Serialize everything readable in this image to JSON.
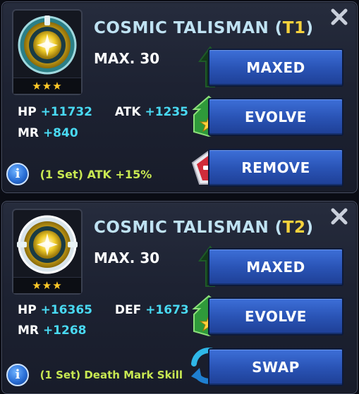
{
  "cards": [
    {
      "title": "COSMIC TALISMAN",
      "tier_open": "(",
      "tier": "T1",
      "tier_close": ")",
      "stars": "★★★",
      "max_level": "MAX. 30",
      "stats": {
        "hp_label": "HP",
        "hp_value": "+11732",
        "second_label": "ATK",
        "second_value": "+1235",
        "mr_label": "MR",
        "mr_value": "+840"
      },
      "set_bonus": "(1 Set) ATK +15%",
      "buttons": {
        "maxed": "MAXED",
        "evolve": "EVOLVE",
        "third": "REMOVE"
      },
      "icons": {
        "item": "cosmic-talisman-icon",
        "maxed": "green-up-arrow-icon",
        "evolve": "green-star-upgrade-icon",
        "third": "red-remove-pentagon-icon",
        "close": "close-icon",
        "info": "info-icon"
      }
    },
    {
      "title": "COSMIC TALISMAN",
      "tier_open": "(",
      "tier": "T2",
      "tier_close": ")",
      "stars": "★★★",
      "max_level": "MAX. 30",
      "stats": {
        "hp_label": "HP",
        "hp_value": "+16365",
        "second_label": "DEF",
        "second_value": "+1673",
        "mr_label": "MR",
        "mr_value": "+1268"
      },
      "set_bonus": "(1 Set) Death Mark Skill",
      "buttons": {
        "maxed": "MAXED",
        "evolve": "EVOLVE",
        "third": "SWAP"
      },
      "icons": {
        "item": "cosmic-talisman-icon",
        "maxed": "green-up-arrow-icon",
        "evolve": "green-star-upgrade-icon",
        "third": "blue-swap-arrows-icon",
        "close": "close-icon",
        "info": "info-icon"
      }
    }
  ],
  "colors": {
    "button_blue": "#2a54b6",
    "stat_value": "#49d9f2",
    "tier_yellow": "#f6d23c",
    "set_bonus_green": "#c8e852",
    "title": "#bfe2f2"
  }
}
